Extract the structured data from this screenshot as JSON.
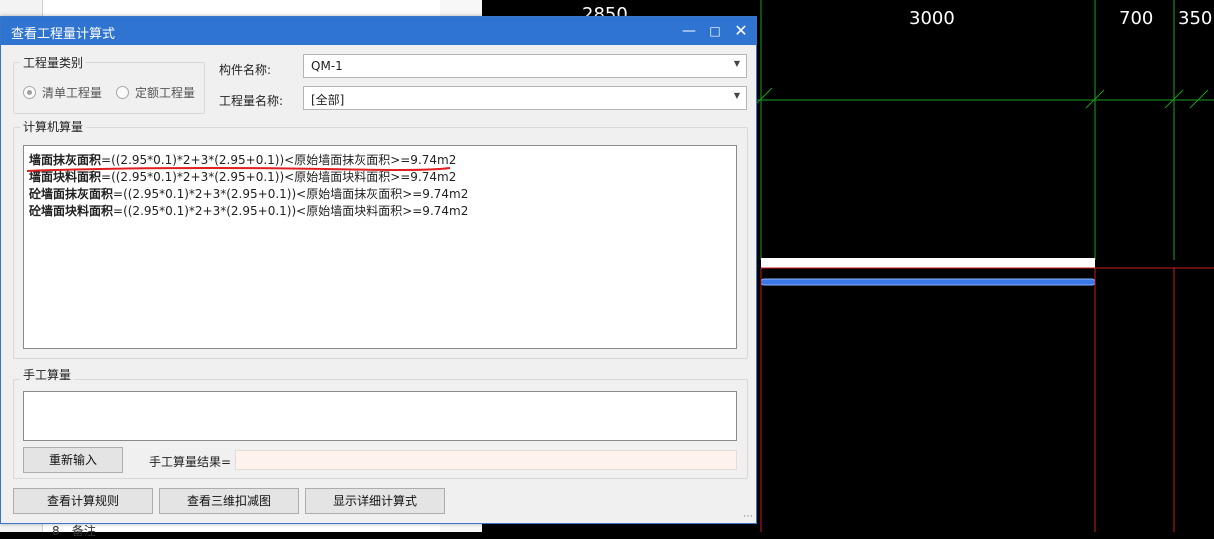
{
  "background_app": {
    "row_number": "8",
    "row_label": "备注"
  },
  "cad": {
    "dimensions": [
      "2850",
      "3000",
      "700",
      "350"
    ],
    "colors": {
      "grid_green": "#1e9e1e",
      "grid_red": "#c81e1e",
      "wall_fill": "#ffffff",
      "selection_blue": "#3b78e7"
    }
  },
  "dialog": {
    "title": "查看工程量计算式",
    "minimize_icon": "minimize-icon",
    "maximize_icon": "maximize-icon",
    "close_icon": "close-icon",
    "quantity_type": {
      "legend": "工程量类别",
      "options": [
        {
          "label": "清单工程量",
          "selected": true
        },
        {
          "label": "定额工程量",
          "selected": false
        }
      ]
    },
    "component_name": {
      "label": "构件名称:",
      "value": "QM-1"
    },
    "quantity_name": {
      "label": "工程量名称:",
      "value": "[全部]"
    },
    "computer_calc": {
      "legend": "计算机算量",
      "lines": [
        {
          "name": "墙面抹灰面积",
          "formula": "=((2.95*0.1)*2+3*(2.95+0.1))<原始墙面抹灰面积>=9.74m2"
        },
        {
          "name": "墙面块料面积",
          "formula": "=((2.95*0.1)*2+3*(2.95+0.1))<原始墙面块料面积>=9.74m2"
        },
        {
          "name": "砼墙面抹灰面积",
          "formula": "=((2.95*0.1)*2+3*(2.95+0.1))<原始墙面抹灰面积>=9.74m2"
        },
        {
          "name": "砼墙面块料面积",
          "formula": "=((2.95*0.1)*2+3*(2.95+0.1))<原始墙面块料面积>=9.74m2"
        }
      ]
    },
    "manual_calc": {
      "legend": "手工算量",
      "reenter_button": "重新输入",
      "result_label": "手工算量结果=",
      "result_value": ""
    },
    "buttons": {
      "view_rules": "查看计算规则",
      "view_3d": "查看三维扣减图",
      "show_detail": "显示详细计算式"
    },
    "annotation_color": "#e02020"
  }
}
